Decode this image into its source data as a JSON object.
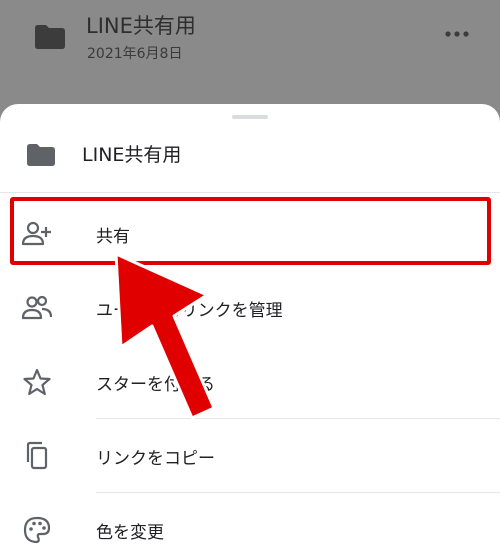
{
  "background_file": {
    "title": "LINE共有用",
    "date": "2021年6月8日",
    "folder_icon": "folder-icon",
    "more_icon": "more-horiz-icon"
  },
  "sheet": {
    "title": "LINE共有用",
    "folder_icon": "folder-icon",
    "items": [
      {
        "label": "共有",
        "icon": "person-add-icon"
      },
      {
        "label": "ユーザーとリンクを管理",
        "icon": "people-icon"
      },
      {
        "label": "スターを付ける",
        "icon": "star-outline-icon"
      },
      {
        "label": "リンクをコピー",
        "icon": "copy-icon"
      },
      {
        "label": "色を変更",
        "icon": "palette-icon"
      }
    ]
  },
  "colors": {
    "highlight": "#e00000",
    "scrim": "#8a8a8a",
    "icon": "#5f6368"
  }
}
